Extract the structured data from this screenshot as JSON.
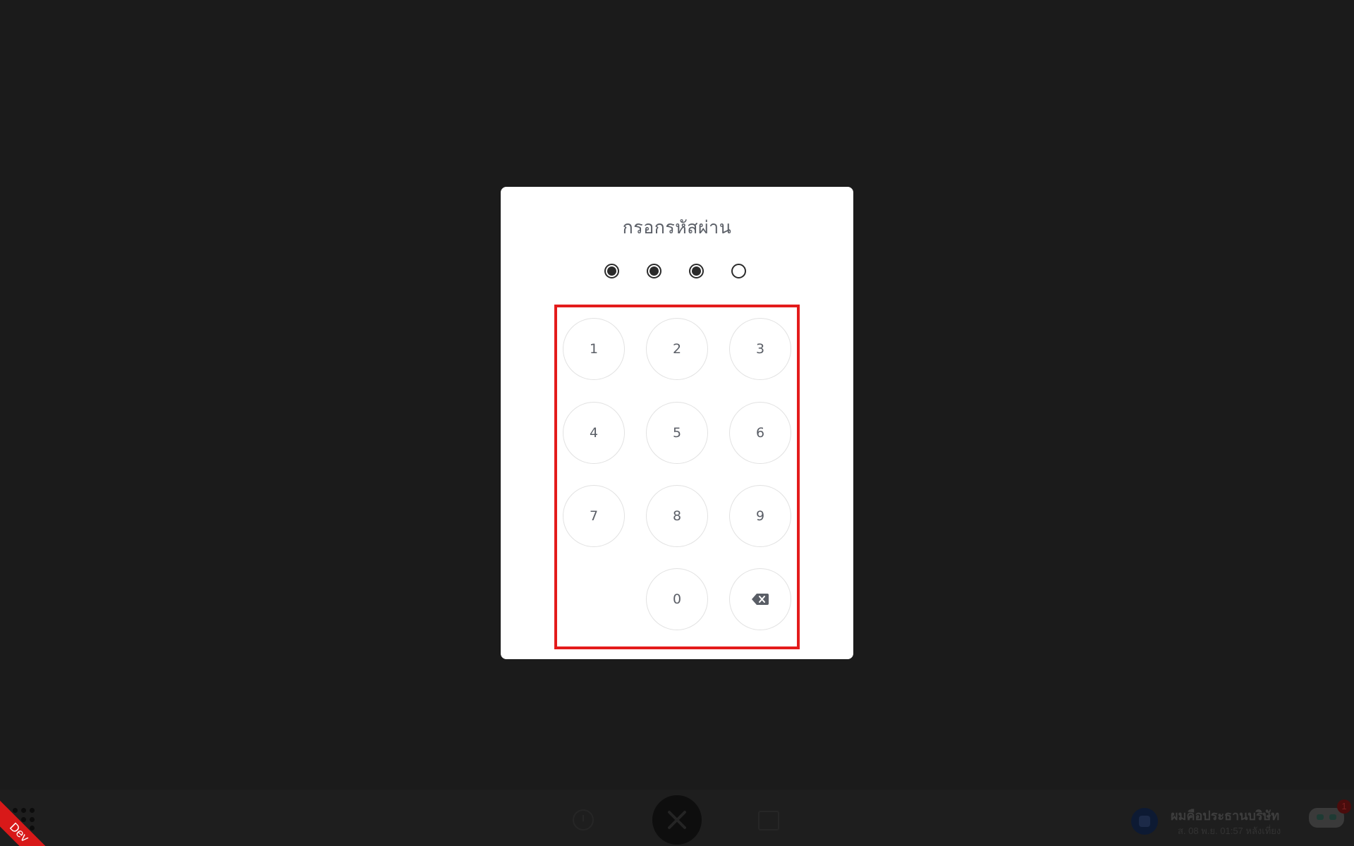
{
  "modal": {
    "title": "กรอกรหัสผ่าน",
    "pin_length": 4,
    "pin_filled": 3,
    "keys": [
      {
        "label": "1"
      },
      {
        "label": "2"
      },
      {
        "label": "3"
      },
      {
        "label": "4"
      },
      {
        "label": "5"
      },
      {
        "label": "6"
      },
      {
        "label": "7"
      },
      {
        "label": "8"
      },
      {
        "label": "9"
      },
      {
        "label": "0"
      }
    ],
    "backspace_icon": "backspace-icon"
  },
  "bottom_bar": {
    "dev_badge": "Dev",
    "apps_icon": "grid-dots-icon",
    "nav": {
      "history_icon": "clock-icon",
      "main_icon": "utensils-icon",
      "store_icon": "store-icon"
    },
    "profile": {
      "name": "ผมคือประธานบริษัท",
      "date": "ส. 08 พ.ย. 01:57 หลังเที่ยง"
    },
    "assistant": {
      "icon": "robot-icon",
      "badge": "1"
    }
  },
  "colors": {
    "backdrop": "#1b1b1b",
    "modal_bg": "#ffffff",
    "highlight_frame": "#e31b1b",
    "dev_badge": "#d81919",
    "text": "#5a5e66"
  }
}
